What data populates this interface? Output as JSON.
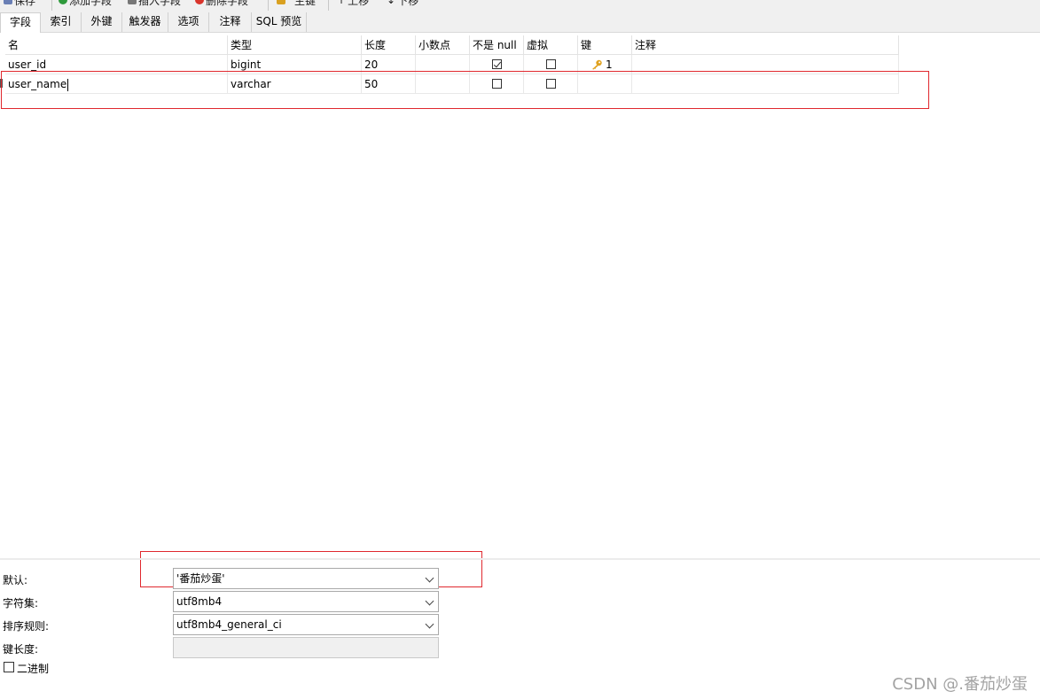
{
  "toolbar": {
    "items": [
      {
        "label": "保存",
        "icon": "save-icon"
      },
      {
        "label": "添加字段",
        "icon": "add-field-icon",
        "color": "#2e9a3c"
      },
      {
        "label": "插入字段",
        "icon": "insert-field-icon",
        "color": "#555555"
      },
      {
        "label": "删除字段",
        "icon": "delete-field-icon",
        "color": "#d9342b"
      },
      {
        "label": "主键",
        "icon": "primary-key-icon",
        "color": "#d9a020"
      },
      {
        "label": "上移",
        "icon": "arrow-up-icon"
      },
      {
        "label": "下移",
        "icon": "arrow-down-icon"
      }
    ]
  },
  "tabs": [
    "字段",
    "索引",
    "外键",
    "触发器",
    "选项",
    "注释",
    "SQL 预览"
  ],
  "active_tab": "字段",
  "grid": {
    "columns": [
      "名",
      "类型",
      "长度",
      "小数点",
      "不是 null",
      "虚拟",
      "键",
      "注释"
    ],
    "rows": [
      {
        "name": "user_id",
        "type": "bigint",
        "length": "20",
        "decimals": "",
        "not_null": true,
        "virtual": false,
        "key": "1",
        "comment": ""
      },
      {
        "name": "user_name",
        "type": "varchar",
        "length": "50",
        "decimals": "",
        "not_null": false,
        "virtual": false,
        "key": "",
        "comment": ""
      }
    ]
  },
  "properties": {
    "default_label": "默认:",
    "default_value": "'番茄炒蛋'",
    "charset_label": "字符集:",
    "charset_value": "utf8mb4",
    "collation_label": "排序规则:",
    "collation_value": "utf8mb4_general_ci",
    "key_length_label": "键长度:",
    "key_length_value": "",
    "binary_label": "二进制"
  },
  "watermark": "CSDN @.番茄炒蛋",
  "colors": {
    "highlight_box": "#e0282e",
    "key_icon": "#e0a21f"
  }
}
